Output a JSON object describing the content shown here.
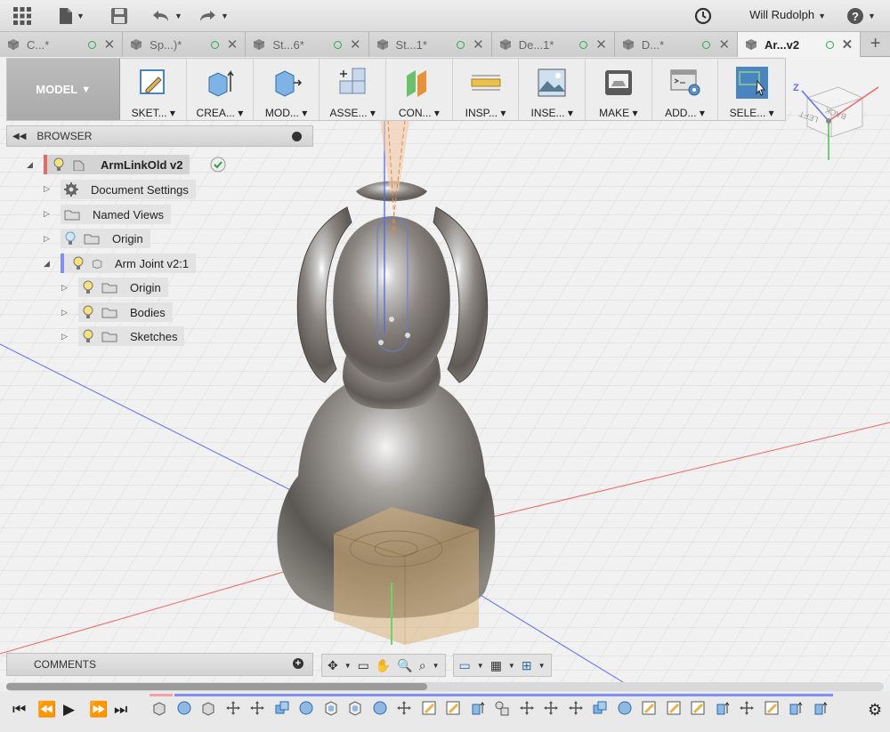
{
  "header": {
    "user_name": "Will Rudolph"
  },
  "tabs": [
    {
      "label": "C...*",
      "active": false
    },
    {
      "label": "Sp...)*",
      "active": false
    },
    {
      "label": "St...6*",
      "active": false
    },
    {
      "label": "St...1*",
      "active": false
    },
    {
      "label": "De...1*",
      "active": false
    },
    {
      "label": "D...*",
      "active": false
    },
    {
      "label": "Ar...v2",
      "active": true
    }
  ],
  "toolbar": {
    "workspace": "MODEL",
    "tools": [
      {
        "label": "SKET...",
        "icon": "sketch-icon"
      },
      {
        "label": "CREA...",
        "icon": "create-icon"
      },
      {
        "label": "MOD...",
        "icon": "modify-icon"
      },
      {
        "label": "ASSE...",
        "icon": "assemble-icon"
      },
      {
        "label": "CON...",
        "icon": "construct-icon"
      },
      {
        "label": "INSP...",
        "icon": "inspect-icon"
      },
      {
        "label": "INSE...",
        "icon": "insert-icon"
      },
      {
        "label": "MAKE",
        "icon": "make-icon"
      },
      {
        "label": "ADD...",
        "icon": "addins-icon"
      },
      {
        "label": "SELE...",
        "icon": "select-icon"
      }
    ]
  },
  "browser": {
    "title": "BROWSER",
    "root": "ArmLinkOld v2",
    "items": [
      {
        "label": "Document Settings"
      },
      {
        "label": "Named Views"
      },
      {
        "label": "Origin"
      },
      {
        "label": "Arm Joint v2:1"
      },
      {
        "label": "Origin"
      },
      {
        "label": "Bodies"
      },
      {
        "label": "Sketches"
      }
    ]
  },
  "comments": {
    "title": "COMMENTS"
  },
  "viewcube": {
    "left_face": "LEFT",
    "back_face": "BACK",
    "axis_label": "Z"
  },
  "colors": {
    "accent": "#4a84c1",
    "status_green": "#2fa84f",
    "timeline_blue": "#7f8ff2"
  }
}
